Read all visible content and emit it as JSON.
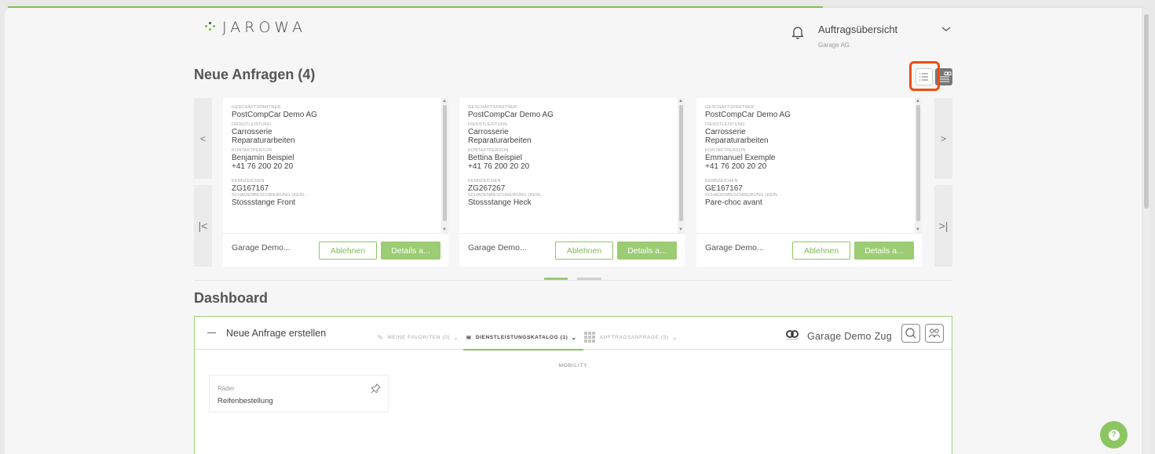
{
  "header": {
    "logo_text": "JAROWA",
    "user_menu_title": "Auftragsübersicht",
    "user_menu_subtitle": "Garage AG"
  },
  "requests": {
    "title": "Neue Anfragen (4)",
    "nav": {
      "prev": "<",
      "next": ">",
      "first": "|<",
      "last": ">|"
    },
    "cards": [
      {
        "partner_label": "GESCHÄFTSPARTNER",
        "partner": "PostCompCar Demo AG",
        "service_label": "DIENSTLEISTUNG",
        "service_line1": "Carrosserie",
        "service_line2": "Reparaturarbeiten",
        "contact_label": "KONTAKTPERSON",
        "contact_name": "Benjamin Beispiel",
        "contact_phone": "+41 76 200 20 20",
        "plate_label": "KENNZEICHEN",
        "plate": "ZG167167",
        "damage_label": "SCHADENBESCHREIBUNG (KEIN...",
        "damage": "Stossstange Front",
        "garage": "Garage Demo...",
        "decline": "Ablehnen",
        "details": "Details a..."
      },
      {
        "partner_label": "GESCHÄFTSPARTNER",
        "partner": "PostCompCar Demo AG",
        "service_label": "DIENSTLEISTUNG",
        "service_line1": "Carrosserie",
        "service_line2": "Reparaturarbeiten",
        "contact_label": "KONTAKTPERSON",
        "contact_name": "Bettina Beispiel",
        "contact_phone": "+41 76 200 20 20",
        "plate_label": "KENNZEICHEN",
        "plate": "ZG267267",
        "damage_label": "SCHADENBESCHREIBUNG (KEIN...",
        "damage": "Stossstange Heck",
        "garage": "Garage Demo...",
        "decline": "Ablehnen",
        "details": "Details a..."
      },
      {
        "partner_label": "GESCHÄFTSPARTNER",
        "partner": "PostCompCar Demo AG",
        "service_label": "DIENSTLEISTUNG",
        "service_line1": "Carrosserie",
        "service_line2": "Reparaturarbeiten",
        "contact_label": "KONTAKTPERSON",
        "contact_name": "Emmanuel Exemple",
        "contact_phone": "+41 76 200 20 20",
        "plate_label": "KENNZEICHEN",
        "plate": "GE167167",
        "damage_label": "SCHADENBESCHREIBUNG (KEIN...",
        "damage": "Pare-choc avant",
        "garage": "Garage Demo...",
        "decline": "Ablehnen",
        "details": "Details a..."
      }
    ]
  },
  "dashboard": {
    "title": "Dashboard",
    "panel_title": "Neue Anfrage erstellen",
    "tabs": [
      {
        "label": "MEINE FAVORITEN (0)",
        "icon": "pin-icon"
      },
      {
        "label": "DIENSTLEISTUNGSKATALOG (1)",
        "icon": "layers-icon",
        "active": true
      },
      {
        "label": "AUFTRAGSANFRAGE (5)",
        "icon": "grid-icon"
      }
    ],
    "company": "Garage Demo Zug",
    "section_label": "MOBILITY",
    "service": {
      "category": "Räder",
      "name": "Reifenbestellung"
    }
  },
  "colors": {
    "accent": "#8bc660",
    "highlight": "#f04d0a"
  }
}
